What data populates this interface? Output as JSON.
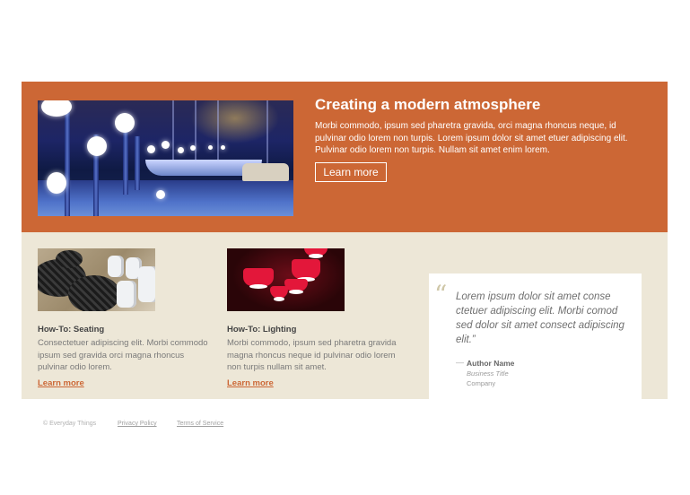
{
  "hero": {
    "title": "Creating a modern atmosphere",
    "text": "Morbi commodo, ipsum sed pharetra gravida, orci magna rhoncus neque, id pulvinar odio lorem non turpis. Lorem ipsum dolor sit amet etuer adipiscing elit. Pulvinar odio lorem non turpis. Nullam sit amet enim lorem.",
    "button_label": "Learn more"
  },
  "cards": [
    {
      "title": "How-To: Seating",
      "text": "Consectetuer adipiscing elit. Morbi commodo ipsum sed gravida orci magna rhoncus pulvinar odio lorem.",
      "link": "Learn more"
    },
    {
      "title": "How-To: Lighting",
      "text": "Morbi commodo, ipsum sed pharetra gravida magna rhoncus neque id pulvinar odio lorem non turpis nullam sit amet.",
      "link": "Learn more"
    }
  ],
  "testimonial": {
    "quote_mark": "“",
    "text": "Lorem ipsum dolor sit amet conse ctetuer adipiscing elit. Morbi comod sed dolor sit amet consect adipiscing elit.”",
    "dash": "—",
    "author_name": "Author Name",
    "author_title": "Business Title",
    "company": "Company"
  },
  "footer": {
    "copyright": "© Everyday Things",
    "privacy": "Privacy Policy",
    "terms": "Terms of Service"
  },
  "colors": {
    "accent": "#cc6735",
    "content_bg": "#ede7d7"
  }
}
